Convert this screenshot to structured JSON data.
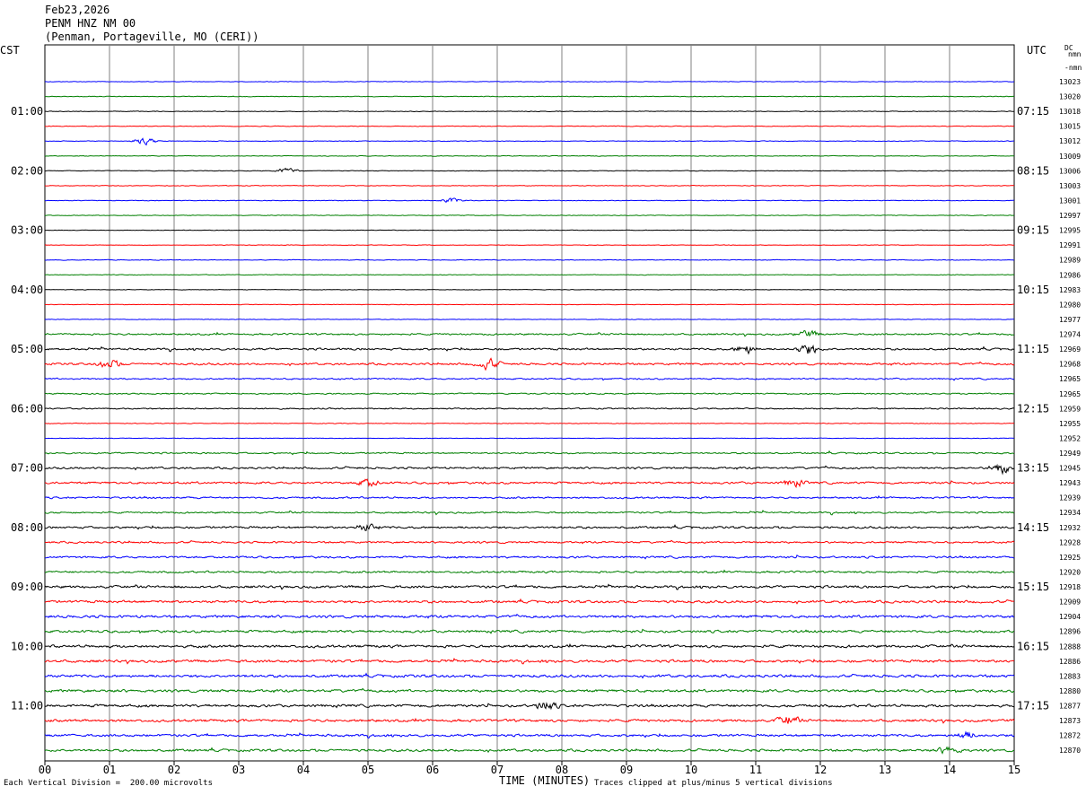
{
  "header": {
    "date": "Feb23,2026",
    "station": "PENM HNZ NM 00",
    "location": "(Penman, Portageville, MO (CERI))"
  },
  "left_tz": "CST",
  "right_tz": "UTC",
  "dc_label": "DC",
  "dc_sub": "nmn",
  "dc_first": "-nmn",
  "footer": {
    "xlabel": "TIME (MINUTES)",
    "scale_note": "Each Vertical Division =  200.00 microvolts",
    "clip_note": "Traces clipped at plus/minus 5 vertical divisions"
  },
  "colors": {
    "black": "#000000",
    "red": "#ff0000",
    "blue": "#0000ff",
    "green": "#007f00",
    "grid": "#808080"
  },
  "chart_data": {
    "type": "line",
    "title": "PENM HNZ NM 00",
    "xlabel": "TIME (MINUTES)",
    "xlim": [
      0,
      15
    ],
    "x_ticks": [
      "00",
      "01",
      "02",
      "03",
      "04",
      "05",
      "06",
      "07",
      "08",
      "09",
      "10",
      "11",
      "12",
      "13",
      "14",
      "15"
    ],
    "left_hour_labels": [
      "01:00",
      "02:00",
      "03:00",
      "04:00",
      "05:00",
      "06:00",
      "07:00",
      "08:00",
      "09:00",
      "10:00",
      "11:00"
    ],
    "right_hour_labels": [
      "07:15",
      "08:15",
      "09:15",
      "10:15",
      "11:15",
      "12:15",
      "13:15",
      "14:15",
      "15:15",
      "16:15",
      "17:15"
    ],
    "dc_offsets": [
      "13023",
      "13020",
      "13018",
      "13015",
      "13012",
      "13009",
      "13006",
      "13003",
      "13001",
      "12997",
      "12995",
      "12991",
      "12989",
      "12986",
      "12983",
      "12980",
      "12977",
      "12974",
      "12969",
      "12968",
      "12965",
      "12965",
      "12959",
      "12955",
      "12952",
      "12949",
      "12945",
      "12943",
      "12939",
      "12934",
      "12932",
      "12928",
      "12925",
      "12920",
      "12918",
      "12909",
      "12904",
      "12896",
      "12888",
      "12886",
      "12883",
      "12880",
      "12877",
      "12873",
      "12872",
      "12870"
    ],
    "trace_colors": [
      "blue",
      "green",
      "black",
      "red",
      "blue",
      "green",
      "black",
      "red",
      "blue",
      "green",
      "black",
      "red",
      "blue",
      "green",
      "black",
      "red",
      "blue",
      "green",
      "black",
      "red",
      "blue",
      "green",
      "black",
      "red",
      "blue",
      "green",
      "black",
      "red",
      "blue",
      "green",
      "black",
      "red",
      "blue",
      "green",
      "black",
      "red",
      "blue",
      "green",
      "black",
      "red",
      "blue",
      "green",
      "black",
      "red",
      "blue",
      "green"
    ],
    "trace_noise_level": [
      0.4,
      0.5,
      0.5,
      0.5,
      0.5,
      0.5,
      0.5,
      0.5,
      0.5,
      0.5,
      0.4,
      0.4,
      0.5,
      0.5,
      0.4,
      0.4,
      0.4,
      1.3,
      1.5,
      1.5,
      1.1,
      1.0,
      1.0,
      0.5,
      0.4,
      1.1,
      1.5,
      1.6,
      1.3,
      1.2,
      1.6,
      1.4,
      1.5,
      1.5,
      1.9,
      1.9,
      2.0,
      1.9,
      2.0,
      2.0,
      2.0,
      2.0,
      2.0,
      1.9,
      1.8,
      1.8
    ],
    "events": [
      {
        "trace": 4,
        "minute": 1.55,
        "amp": 4
      },
      {
        "trace": 6,
        "minute": 3.75,
        "amp": 3
      },
      {
        "trace": 8,
        "minute": 6.3,
        "amp": 2.5
      },
      {
        "trace": 17,
        "minute": 11.8,
        "amp": 4
      },
      {
        "trace": 18,
        "minute": 10.85,
        "amp": 5
      },
      {
        "trace": 18,
        "minute": 11.8,
        "amp": 6
      },
      {
        "trace": 19,
        "minute": 6.85,
        "amp": 6
      },
      {
        "trace": 19,
        "minute": 1.0,
        "amp": 5
      },
      {
        "trace": 26,
        "minute": 14.8,
        "amp": 6
      },
      {
        "trace": 27,
        "minute": 5.0,
        "amp": 4
      },
      {
        "trace": 27,
        "minute": 11.6,
        "amp": 4
      },
      {
        "trace": 30,
        "minute": 5.0,
        "amp": 4
      },
      {
        "trace": 42,
        "minute": 7.75,
        "amp": 5
      },
      {
        "trace": 43,
        "minute": 11.5,
        "amp": 5
      },
      {
        "trace": 44,
        "minute": 14.25,
        "amp": 4
      },
      {
        "trace": 45,
        "minute": 14.0,
        "amp": 4
      }
    ]
  }
}
